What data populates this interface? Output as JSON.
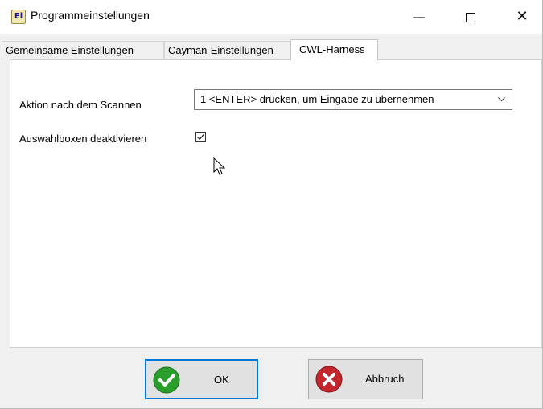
{
  "window": {
    "title": "Programmeinstellungen",
    "app_icon_text": "El",
    "minimize_label": "—",
    "close_label": "✕"
  },
  "tabs": [
    {
      "label": "Gemeinsame Einstellungen",
      "selected": false
    },
    {
      "label": "Cayman-Einstellungen",
      "selected": false
    },
    {
      "label": "CWL-Harness",
      "selected": true
    }
  ],
  "form": {
    "action_label": "Aktion nach dem Scannen",
    "action_value": "1 <ENTER> drücken, um Eingabe zu übernehmen",
    "disable_checkboxes_label": "Auswahlboxen deaktivieren",
    "disable_checkboxes_checked": true
  },
  "buttons": {
    "ok_label": "OK",
    "cancel_label": "Abbruch"
  },
  "icons": {
    "ok": "check-circle-icon",
    "cancel": "x-circle-icon",
    "ok_color": "#2a9d2a",
    "cancel_color": "#c4262e"
  },
  "colors": {
    "focus_border": "#0078d7",
    "dialog_bg": "#f0f0f0"
  }
}
